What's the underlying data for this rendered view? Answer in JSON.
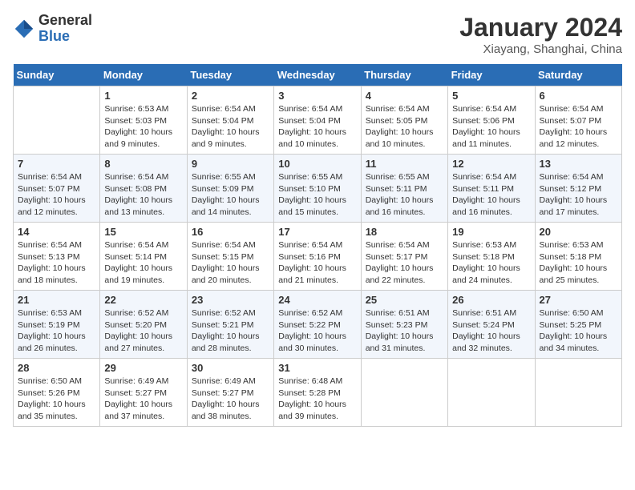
{
  "logo": {
    "text_general": "General",
    "text_blue": "Blue"
  },
  "title": "January 2024",
  "subtitle": "Xiayang, Shanghai, China",
  "headers": [
    "Sunday",
    "Monday",
    "Tuesday",
    "Wednesday",
    "Thursday",
    "Friday",
    "Saturday"
  ],
  "weeks": [
    [
      {
        "day": "",
        "info": ""
      },
      {
        "day": "1",
        "info": "Sunrise: 6:53 AM\nSunset: 5:03 PM\nDaylight: 10 hours\nand 9 minutes."
      },
      {
        "day": "2",
        "info": "Sunrise: 6:54 AM\nSunset: 5:04 PM\nDaylight: 10 hours\nand 9 minutes."
      },
      {
        "day": "3",
        "info": "Sunrise: 6:54 AM\nSunset: 5:04 PM\nDaylight: 10 hours\nand 10 minutes."
      },
      {
        "day": "4",
        "info": "Sunrise: 6:54 AM\nSunset: 5:05 PM\nDaylight: 10 hours\nand 10 minutes."
      },
      {
        "day": "5",
        "info": "Sunrise: 6:54 AM\nSunset: 5:06 PM\nDaylight: 10 hours\nand 11 minutes."
      },
      {
        "day": "6",
        "info": "Sunrise: 6:54 AM\nSunset: 5:07 PM\nDaylight: 10 hours\nand 12 minutes."
      }
    ],
    [
      {
        "day": "7",
        "info": "Sunrise: 6:54 AM\nSunset: 5:07 PM\nDaylight: 10 hours\nand 12 minutes."
      },
      {
        "day": "8",
        "info": "Sunrise: 6:54 AM\nSunset: 5:08 PM\nDaylight: 10 hours\nand 13 minutes."
      },
      {
        "day": "9",
        "info": "Sunrise: 6:55 AM\nSunset: 5:09 PM\nDaylight: 10 hours\nand 14 minutes."
      },
      {
        "day": "10",
        "info": "Sunrise: 6:55 AM\nSunset: 5:10 PM\nDaylight: 10 hours\nand 15 minutes."
      },
      {
        "day": "11",
        "info": "Sunrise: 6:55 AM\nSunset: 5:11 PM\nDaylight: 10 hours\nand 16 minutes."
      },
      {
        "day": "12",
        "info": "Sunrise: 6:54 AM\nSunset: 5:11 PM\nDaylight: 10 hours\nand 16 minutes."
      },
      {
        "day": "13",
        "info": "Sunrise: 6:54 AM\nSunset: 5:12 PM\nDaylight: 10 hours\nand 17 minutes."
      }
    ],
    [
      {
        "day": "14",
        "info": "Sunrise: 6:54 AM\nSunset: 5:13 PM\nDaylight: 10 hours\nand 18 minutes."
      },
      {
        "day": "15",
        "info": "Sunrise: 6:54 AM\nSunset: 5:14 PM\nDaylight: 10 hours\nand 19 minutes."
      },
      {
        "day": "16",
        "info": "Sunrise: 6:54 AM\nSunset: 5:15 PM\nDaylight: 10 hours\nand 20 minutes."
      },
      {
        "day": "17",
        "info": "Sunrise: 6:54 AM\nSunset: 5:16 PM\nDaylight: 10 hours\nand 21 minutes."
      },
      {
        "day": "18",
        "info": "Sunrise: 6:54 AM\nSunset: 5:17 PM\nDaylight: 10 hours\nand 22 minutes."
      },
      {
        "day": "19",
        "info": "Sunrise: 6:53 AM\nSunset: 5:18 PM\nDaylight: 10 hours\nand 24 minutes."
      },
      {
        "day": "20",
        "info": "Sunrise: 6:53 AM\nSunset: 5:18 PM\nDaylight: 10 hours\nand 25 minutes."
      }
    ],
    [
      {
        "day": "21",
        "info": "Sunrise: 6:53 AM\nSunset: 5:19 PM\nDaylight: 10 hours\nand 26 minutes."
      },
      {
        "day": "22",
        "info": "Sunrise: 6:52 AM\nSunset: 5:20 PM\nDaylight: 10 hours\nand 27 minutes."
      },
      {
        "day": "23",
        "info": "Sunrise: 6:52 AM\nSunset: 5:21 PM\nDaylight: 10 hours\nand 28 minutes."
      },
      {
        "day": "24",
        "info": "Sunrise: 6:52 AM\nSunset: 5:22 PM\nDaylight: 10 hours\nand 30 minutes."
      },
      {
        "day": "25",
        "info": "Sunrise: 6:51 AM\nSunset: 5:23 PM\nDaylight: 10 hours\nand 31 minutes."
      },
      {
        "day": "26",
        "info": "Sunrise: 6:51 AM\nSunset: 5:24 PM\nDaylight: 10 hours\nand 32 minutes."
      },
      {
        "day": "27",
        "info": "Sunrise: 6:50 AM\nSunset: 5:25 PM\nDaylight: 10 hours\nand 34 minutes."
      }
    ],
    [
      {
        "day": "28",
        "info": "Sunrise: 6:50 AM\nSunset: 5:26 PM\nDaylight: 10 hours\nand 35 minutes."
      },
      {
        "day": "29",
        "info": "Sunrise: 6:49 AM\nSunset: 5:27 PM\nDaylight: 10 hours\nand 37 minutes."
      },
      {
        "day": "30",
        "info": "Sunrise: 6:49 AM\nSunset: 5:27 PM\nDaylight: 10 hours\nand 38 minutes."
      },
      {
        "day": "31",
        "info": "Sunrise: 6:48 AM\nSunset: 5:28 PM\nDaylight: 10 hours\nand 39 minutes."
      },
      {
        "day": "",
        "info": ""
      },
      {
        "day": "",
        "info": ""
      },
      {
        "day": "",
        "info": ""
      }
    ]
  ]
}
